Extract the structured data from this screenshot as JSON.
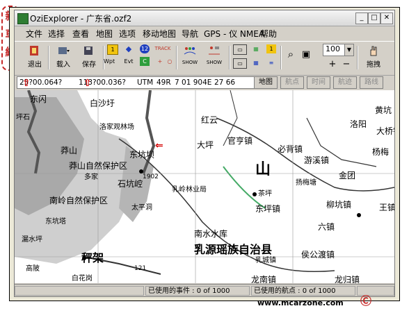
{
  "window": {
    "title": "OziExplorer - 广东省.ozf2"
  },
  "menu": [
    "文件",
    "选择",
    "查看",
    "地图",
    "选项",
    "移动地图",
    "导航",
    "GPS - 仪 NMEA",
    "帮助"
  ],
  "toolbar": {
    "exit": "退出",
    "load": "载入",
    "save": "保存",
    "wpt": "Wpt",
    "evt": "Evt",
    "trk_num": "12",
    "track": "TRACK",
    "show1": "SHOW",
    "show2": "SHOW",
    "drag": "拖拽"
  },
  "zoom": {
    "value": "100"
  },
  "coords": {
    "lat": "25?00.064?",
    "lon": "113?00.036?",
    "utm": "UTM",
    "zone": "49R",
    "easting": "7 01 904E",
    "northing": "27 66 556N"
  },
  "coord_buttons": [
    "地图",
    "航点",
    "时间",
    "航迹",
    "路线"
  ],
  "map_labels": [
    "东闪",
    "白沙圩",
    "洛家观林场",
    "莽山",
    "莽山自然保护区",
    "多家",
    "东坑坝",
    "石坑崆",
    "南岭自然保护区",
    "太平洞",
    "东坑塔",
    "漏水坪",
    "秤架",
    "高陂",
    "白花岗",
    "红云",
    "大坪",
    "官亨镇",
    "必背镇",
    "山",
    "游溪镇",
    "杨梅",
    "金团",
    "乳岭林业局",
    "茶坪",
    "扬梅塘",
    "柳坑镇",
    "东坪镇",
    "南水水库",
    "乳源瑶族自治县",
    "乳城镇",
    "侯公渡镇",
    "大桥镇",
    "龙归镇",
    "龙南镇",
    "六镇",
    "王镇",
    "黄坑",
    "洛阳",
    "坪石",
    "1902",
    "121"
  ],
  "status": {
    "events": "已使用的事件 : 0 of 1000",
    "waypoints": "已使用的航点 : 0 of 1000"
  },
  "watermark_url": "www.mcarzone.com",
  "brand_side": "新车网",
  "colors": {
    "red_marker": "#d40000",
    "brand": "#c62828"
  }
}
